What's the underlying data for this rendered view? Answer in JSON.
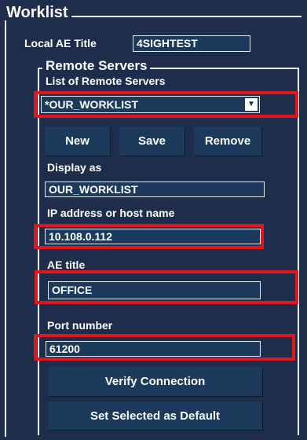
{
  "worklist": {
    "title": "Worklist",
    "local_ae_label": "Local AE Title",
    "local_ae_value": "4SIGHTEST"
  },
  "remote": {
    "title": "Remote Servers",
    "list_label": "List of Remote Servers",
    "selected_server": "*OUR_WORKLIST",
    "buttons": {
      "new": "New",
      "save": "Save",
      "remove": "Remove"
    },
    "display_as_label": "Display as",
    "display_as_value": "OUR_WORKLIST",
    "ip_label": "IP address or host name",
    "ip_value": "10.108.0.112",
    "ae_title_label": "AE title",
    "ae_title_value": "OFFICE",
    "port_label": "Port number",
    "port_value": "61200",
    "verify_button": "Verify Connection",
    "default_button": "Set Selected as Default"
  },
  "colors": {
    "background": "#1f2d4d",
    "field": "#1c3a5c",
    "highlight": "#e4141b"
  }
}
